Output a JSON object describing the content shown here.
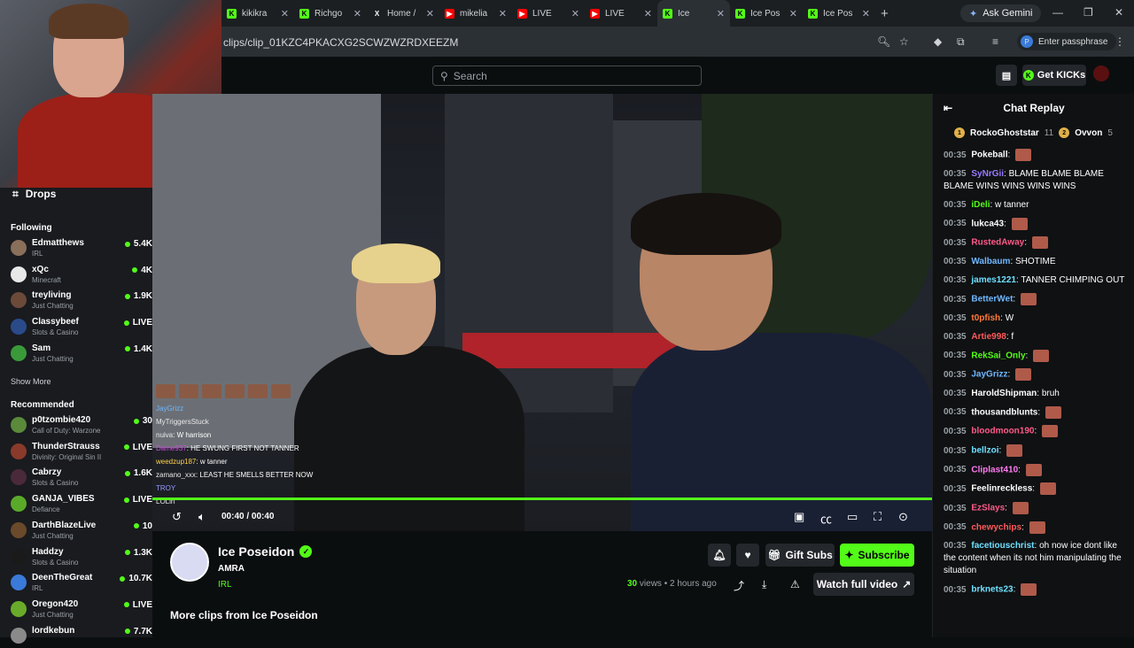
{
  "browser": {
    "tabs": [
      {
        "title": "kikikra",
        "icon": "kick-icon",
        "active": false
      },
      {
        "title": "Richgo",
        "icon": "kick-icon",
        "active": false
      },
      {
        "title": "Home /",
        "icon": "x-icon",
        "active": false
      },
      {
        "title": "mikelia",
        "icon": "youtube-icon",
        "active": false
      },
      {
        "title": "LIVE",
        "icon": "youtube-icon",
        "active": false
      },
      {
        "title": "LIVE",
        "icon": "youtube-icon",
        "active": false
      },
      {
        "title": "Ice",
        "icon": "kick-icon",
        "active": true
      },
      {
        "title": "Ice Pos",
        "icon": "kick-icon",
        "active": false
      },
      {
        "title": "Ice Pos",
        "icon": "kick-icon",
        "active": false
      }
    ],
    "gemini_label": "Ask Gemini",
    "url": "clips/clip_01KZC4PKACXG2SCWZWZRDXEEZM",
    "passphrase_label": "Enter passphrase"
  },
  "header": {
    "search_placeholder": "Search",
    "get_kicks_label": "Get KICKs"
  },
  "sidebar": {
    "drops_label": "Drops",
    "following_title": "Following",
    "following": [
      {
        "name": "Edmatthews",
        "category": "IRL",
        "viewers": "5.4K",
        "color": "#8a6f5a"
      },
      {
        "name": "xQc",
        "category": "Minecraft",
        "viewers": "4K",
        "color": "#e8e8e8"
      },
      {
        "name": "treyliving",
        "category": "Just Chatting",
        "viewers": "1.9K",
        "color": "#6b4a3a"
      },
      {
        "name": "Classybeef",
        "category": "Slots & Casino",
        "viewers": "LIVE",
        "color": "#2a4a8a"
      },
      {
        "name": "Sam",
        "category": "Just Chatting",
        "viewers": "1.4K",
        "color": "#3a9a3a"
      }
    ],
    "show_more": "Show More",
    "recommended_title": "Recommended",
    "recommended": [
      {
        "name": "p0tzombie420",
        "category": "Call of Duty: Warzone",
        "viewers": "30",
        "color": "#5a8a3a"
      },
      {
        "name": "ThunderStrauss",
        "category": "Divinity: Original Sin II",
        "viewers": "LIVE",
        "color": "#8a3a2a"
      },
      {
        "name": "Cabrzy",
        "category": "Slots & Casino",
        "viewers": "1.6K",
        "color": "#4a2a3a"
      },
      {
        "name": "GANJA_VIBES",
        "category": "Defiance",
        "viewers": "LIVE",
        "color": "#5aaa2a"
      },
      {
        "name": "DarthBlazeLive",
        "category": "Just Chatting",
        "viewers": "10",
        "color": "#6a4a2a"
      },
      {
        "name": "Haddzy",
        "category": "Slots & Casino",
        "viewers": "1.3K",
        "color": "#1a1a1a"
      },
      {
        "name": "DeenTheGreat",
        "category": "IRL",
        "viewers": "10.7K",
        "color": "#3a7ad8"
      },
      {
        "name": "Oregon420",
        "category": "Just Chatting",
        "viewers": "LIVE",
        "color": "#6aaa2a"
      },
      {
        "name": "lordkebun",
        "category": "",
        "viewers": "7.7K",
        "color": "#8a8a8a"
      }
    ]
  },
  "video": {
    "overlay_chat": [
      {
        "user": "JayGrizz",
        "text": "",
        "cls": "u1"
      },
      {
        "user": "MyTriggersStuck",
        "text": "",
        "cls": "u2"
      },
      {
        "user": "nuiva",
        "text": "W harrison",
        "cls": "u2"
      },
      {
        "user": "Dame937",
        "text": "HE SWUNG FIRST NOT TANNER",
        "cls": "u3"
      },
      {
        "user": "weedzup187",
        "text": "w tanner",
        "cls": "u4"
      },
      {
        "user": "zamano_xxx",
        "text": "LEAST HE SMELLS BETTER NOW",
        "cls": "u2"
      },
      {
        "user": "TROY",
        "text": "",
        "cls": "u5"
      },
      {
        "user": "LOLirf",
        "text": "",
        "cls": "u2"
      }
    ],
    "time": "00:40 / 00:40",
    "progress": 1.0
  },
  "clip": {
    "channel": "Ice Poseidon",
    "title": "AMRA",
    "category": "IRL",
    "views": "30",
    "views_label": "views",
    "age": "• 2 hours ago",
    "gift_subs": "Gift Subs",
    "subscribe": "Subscribe",
    "watch_full": "Watch full video",
    "more_clips": "More clips from Ice Poseidon"
  },
  "chat": {
    "title": "Chat Replay",
    "leaders": [
      {
        "name": "RockoGhoststar",
        "count": "11"
      },
      {
        "name": "Ovvon",
        "count": "5"
      }
    ],
    "messages": [
      {
        "time": "00:35",
        "user": "Pokeball",
        "text": "",
        "color": "#ffffff",
        "emote": true
      },
      {
        "time": "00:35",
        "user": "SyNrGii",
        "text": "BLAME BLAME BLAME BLAME WINS WINS WINS WINS",
        "color": "#9a7aff",
        "emote": false
      },
      {
        "time": "00:35",
        "user": "iDeli",
        "text": "w tanner",
        "color": "#53fc18",
        "emote": false
      },
      {
        "time": "00:35",
        "user": "lukca43",
        "text": "",
        "color": "#ffffff",
        "emote": true
      },
      {
        "time": "00:35",
        "user": "RustedAway",
        "text": "",
        "color": "#ff5a8a",
        "emote": true
      },
      {
        "time": "00:35",
        "user": "Walbaum",
        "text": "SHOTIME",
        "color": "#6fb7ff",
        "emote": false
      },
      {
        "time": "00:35",
        "user": "james1221",
        "text": "TANNER CHIMPING OUT",
        "color": "#6fe0ff",
        "emote": false
      },
      {
        "time": "00:35",
        "user": "BetterWet",
        "text": "",
        "color": "#6fb7ff",
        "emote": true
      },
      {
        "time": "00:35",
        "user": "t0pfish",
        "text": "W",
        "color": "#ff7a3a",
        "emote": false
      },
      {
        "time": "00:35",
        "user": "Artie998",
        "text": "f",
        "color": "#ff5a5a",
        "emote": false
      },
      {
        "time": "00:35",
        "user": "RekSai_Only",
        "text": "",
        "color": "#53fc18",
        "emote": true
      },
      {
        "time": "00:35",
        "user": "JayGrizz",
        "text": "",
        "color": "#6fb7ff",
        "emote": true
      },
      {
        "time": "00:35",
        "user": "HaroldShipman",
        "text": "bruh",
        "color": "#ffffff",
        "emote": false
      },
      {
        "time": "00:35",
        "user": "thousandblunts",
        "text": "",
        "color": "#ffffff",
        "emote": true
      },
      {
        "time": "00:35",
        "user": "bloodmoon190",
        "text": "",
        "color": "#ff5a8a",
        "emote": true
      },
      {
        "time": "00:35",
        "user": "bellzoi",
        "text": "",
        "color": "#6fe0ff",
        "emote": true
      },
      {
        "time": "00:35",
        "user": "Cliplast410",
        "text": "",
        "color": "#ff7af0",
        "emote": true
      },
      {
        "time": "00:35",
        "user": "Feelinreckless",
        "text": "",
        "color": "#ffffff",
        "emote": true
      },
      {
        "time": "00:35",
        "user": "EzSlays",
        "text": "",
        "color": "#ff5a8a",
        "emote": true
      },
      {
        "time": "00:35",
        "user": "chewychips",
        "text": "",
        "color": "#ff5a5a",
        "emote": true
      },
      {
        "time": "00:35",
        "user": "facetiouschrist",
        "text": "oh now ice dont like the content when its not him manipulating the situation",
        "color": "#6fe0ff",
        "emote": false
      },
      {
        "time": "00:35",
        "user": "brknets23",
        "text": "",
        "color": "#6fe0ff",
        "emote": true
      }
    ]
  }
}
